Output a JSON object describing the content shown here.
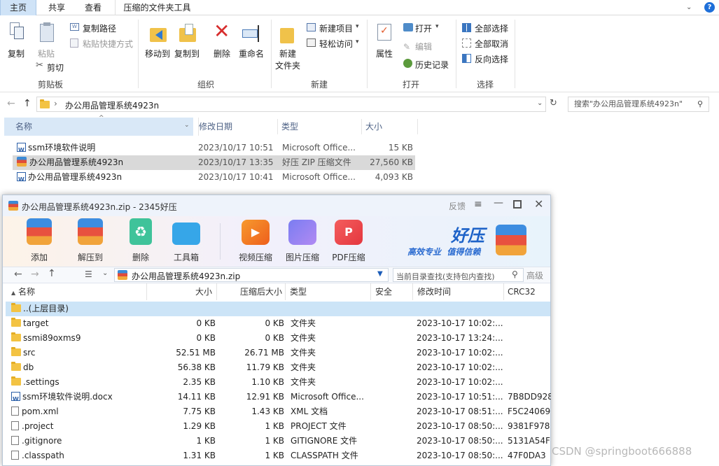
{
  "ribbon": {
    "tabs": [
      "主页",
      "共享",
      "查看",
      "压缩的文件夹工具"
    ],
    "help_icon": "question-icon",
    "clipboard": {
      "copy": "复制",
      "paste": "粘贴",
      "copy_path": "复制路径",
      "paste_shortcut": "粘贴快捷方式",
      "cut": "剪切",
      "group": "剪贴板"
    },
    "organize": {
      "move_to": "移动到",
      "copy_to": "复制到",
      "delete": "删除",
      "rename": "重命名",
      "group": "组织"
    },
    "new": {
      "new_folder_line1": "新建",
      "new_folder_line2": "文件夹",
      "new_item": "新建项目",
      "easy_access": "轻松访问",
      "group": "新建"
    },
    "open": {
      "properties": "属性",
      "open": "打开",
      "edit": "编辑",
      "history": "历史记录",
      "group": "打开"
    },
    "select": {
      "select_all": "全部选择",
      "select_none": "全部取消",
      "invert": "反向选择",
      "group": "选择"
    }
  },
  "address": {
    "path": "办公用品管理系统4923n",
    "search_placeholder": "搜索\"办公用品管理系统4923n\""
  },
  "explorer": {
    "columns": [
      "名称",
      "修改日期",
      "类型",
      "大小"
    ],
    "rows": [
      {
        "name": "ssm环境软件说明",
        "date": "2023/10/17 10:51",
        "type": "Microsoft Office...",
        "size": "15 KB",
        "icon": "word-doc-icon"
      },
      {
        "name": "办公用品管理系统4923n",
        "date": "2023/10/17 13:35",
        "type": "好压 ZIP 压缩文件",
        "size": "27,560 KB",
        "icon": "zip-icon"
      },
      {
        "name": "办公用品管理系统4923n",
        "date": "2023/10/17 10:41",
        "type": "Microsoft Office...",
        "size": "4,093 KB",
        "icon": "word-doc-icon"
      }
    ]
  },
  "haozip": {
    "title": "办公用品管理系统4923n.zip - 2345好压",
    "feedback": "反馈",
    "toolbar": [
      "添加",
      "解压到",
      "删除",
      "工具箱",
      "视频压缩",
      "图片压缩",
      "PDF压缩"
    ],
    "brand": "好压",
    "slogan": "高效专业  值得信赖",
    "path": "办公用品管理系统4923n.zip",
    "search_placeholder": "当前目录查找(支持包内查找)",
    "advanced": "高级",
    "columns": [
      "名称",
      "大小",
      "压缩后大小",
      "类型",
      "安全",
      "修改时间",
      "CRC32"
    ],
    "rows": [
      {
        "name": "..(上层目录)",
        "size": "",
        "csize": "",
        "type": "",
        "mtime": "",
        "crc": "",
        "icon": "folder"
      },
      {
        "name": "target",
        "size": "0 KB",
        "csize": "0 KB",
        "type": "文件夹",
        "mtime": "2023-10-17 10:02:...",
        "crc": "",
        "icon": "folder"
      },
      {
        "name": "ssmi89oxms9",
        "size": "0 KB",
        "csize": "0 KB",
        "type": "文件夹",
        "mtime": "2023-10-17 13:24:...",
        "crc": "",
        "icon": "folder"
      },
      {
        "name": "src",
        "size": "52.51 MB",
        "csize": "26.71 MB",
        "type": "文件夹",
        "mtime": "2023-10-17 10:02:...",
        "crc": "",
        "icon": "folder"
      },
      {
        "name": "db",
        "size": "56.38 KB",
        "csize": "11.79 KB",
        "type": "文件夹",
        "mtime": "2023-10-17 10:02:...",
        "crc": "",
        "icon": "folder"
      },
      {
        "name": ".settings",
        "size": "2.35 KB",
        "csize": "1.10 KB",
        "type": "文件夹",
        "mtime": "2023-10-17 10:02:...",
        "crc": "",
        "icon": "folder"
      },
      {
        "name": "ssm环境软件说明.docx",
        "size": "14.11 KB",
        "csize": "12.91 KB",
        "type": "Microsoft Office...",
        "mtime": "2023-10-17 10:51:...",
        "crc": "7B8DD928",
        "icon": "word"
      },
      {
        "name": "pom.xml",
        "size": "7.75 KB",
        "csize": "1.43 KB",
        "type": "XML 文档",
        "mtime": "2023-10-17 08:51:...",
        "crc": "F5C24069",
        "icon": "doc"
      },
      {
        "name": ".project",
        "size": "1.29 KB",
        "csize": "1 KB",
        "type": "PROJECT 文件",
        "mtime": "2023-10-17 08:50:...",
        "crc": "9381F978",
        "icon": "doc"
      },
      {
        "name": ".gitignore",
        "size": "1 KB",
        "csize": "1 KB",
        "type": "GITIGNORE 文件",
        "mtime": "2023-10-17 08:50:...",
        "crc": "5131A54F",
        "icon": "doc"
      },
      {
        "name": ".classpath",
        "size": "1.31 KB",
        "csize": "1 KB",
        "type": "CLASSPATH 文件",
        "mtime": "2023-10-17 08:50:...",
        "crc": "47F0DA3",
        "icon": "doc"
      }
    ]
  },
  "watermark": "CSDN @springboot666888"
}
